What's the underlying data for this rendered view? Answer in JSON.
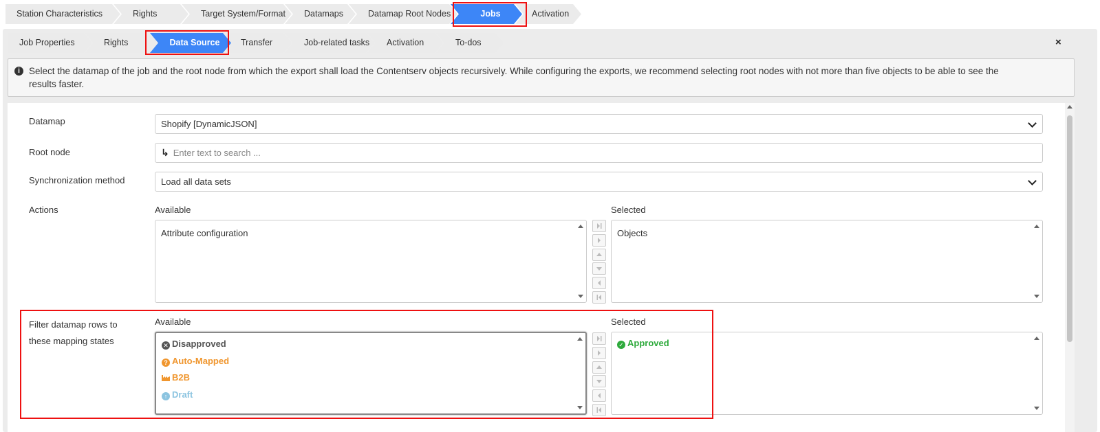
{
  "top_steps": [
    "Station Characteristics",
    "Rights",
    "Target System/Format",
    "Datamaps",
    "Datamap Root Nodes",
    "Jobs",
    "Activation"
  ],
  "top_active": "Jobs",
  "sub_steps": [
    "Job Properties",
    "Rights",
    "Data Source",
    "Transfer",
    "Job-related tasks",
    "Activation",
    "To-dos"
  ],
  "sub_active": "Data Source",
  "close_label": "×",
  "info": {
    "line1": "Select the datamap of the job and the root node from which the export shall load the Contentserv objects recursively. While configuring the exports, we recommend selecting root nodes with not more than five objects to be able to see the",
    "line2": "results faster."
  },
  "form": {
    "datamap_label": "Datamap",
    "datamap_value": "Shopify [DynamicJSON]",
    "root_label": "Root node",
    "root_placeholder": "Enter text to search ...",
    "sync_label": "Synchronization method",
    "sync_value": "Load all data sets",
    "actions_label": "Actions",
    "available_label": "Available",
    "selected_label": "Selected",
    "actions_available": [
      "Attribute configuration"
    ],
    "actions_selected": [
      "Objects"
    ],
    "filter_label_line1": "Filter datamap rows to",
    "filter_label_line2": "these mapping states",
    "states_available": [
      {
        "label": "Disapproved",
        "icon": "x-circle-icon",
        "color": "#555555"
      },
      {
        "label": "Auto-Mapped",
        "icon": "question-circle-icon",
        "color": "#f0962e"
      },
      {
        "label": "B2B",
        "icon": "factory-icon",
        "color": "#f0962e"
      },
      {
        "label": "Draft",
        "icon": "arrow-up-circle-icon",
        "color": "#8cc4e0"
      }
    ],
    "states_selected": [
      {
        "label": "Approved",
        "icon": "check-circle-icon",
        "color": "#2eaa3c"
      }
    ]
  },
  "colors": {
    "accent": "#3d86f7",
    "highlight_box": "#e11111"
  }
}
